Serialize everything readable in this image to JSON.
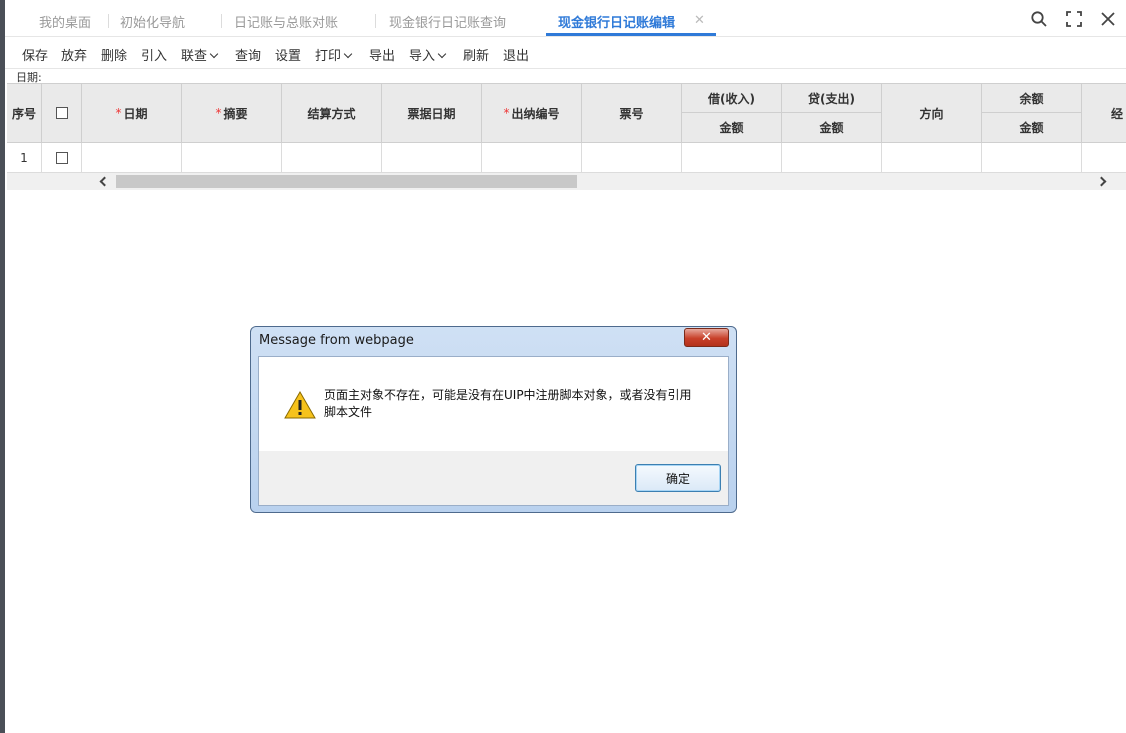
{
  "tabs": [
    {
      "label": "我的桌面"
    },
    {
      "label": "初始化导航"
    },
    {
      "label": "日记账与总账对账"
    },
    {
      "label": "现金银行日记账查询"
    },
    {
      "label": "现金银行日记账编辑",
      "active": true
    }
  ],
  "window_icons": [
    "search-icon",
    "fullscreen-icon",
    "close-icon"
  ],
  "toolbar": {
    "save": "保存",
    "discard": "放弃",
    "delete": "删除",
    "import_ref": "引入",
    "linked_query": "联查",
    "query": "查询",
    "settings": "设置",
    "print": "打印",
    "export": "导出",
    "import": "导入",
    "refresh": "刷新",
    "exit": "退出"
  },
  "date_label": "日期:",
  "grid": {
    "headers": {
      "seq": "序号",
      "date": "日期",
      "summary": "摘要",
      "settlement": "结算方式",
      "bill_date": "票据日期",
      "cashier_no": "出纳编号",
      "bill_no": "票号",
      "debit": "借(收入)",
      "credit": "贷(支出)",
      "direction": "方向",
      "balance": "余额",
      "amount": "金额",
      "handler": "经"
    },
    "rows": [
      {
        "seq": "1"
      }
    ]
  },
  "dialog": {
    "title": "Message from webpage",
    "message_line1": "页面主对象不存在，可能是没有在UIP中注册脚本对象，或者没有引用",
    "message_line2": "脚本文件",
    "ok": "确定"
  },
  "colors": {
    "accent": "#2f7ad8",
    "required": "#ee3333",
    "header_bg": "#eaeaea"
  }
}
